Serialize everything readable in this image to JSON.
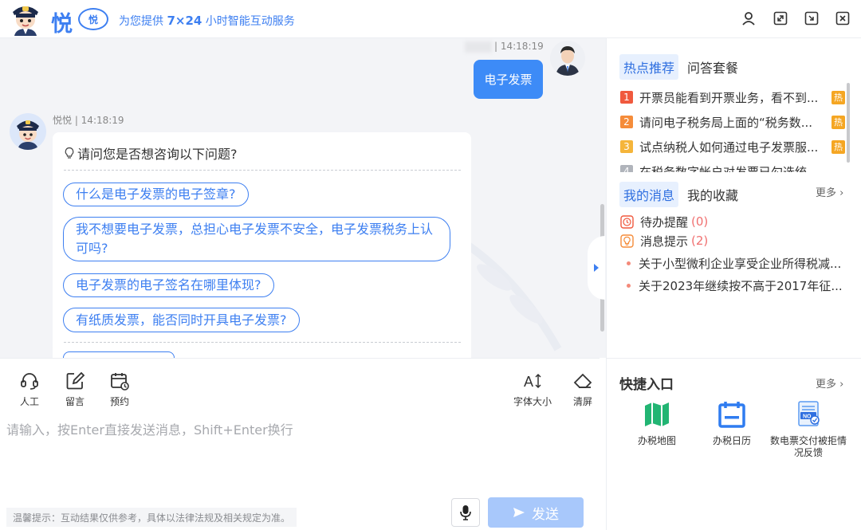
{
  "header": {
    "brand": "悦",
    "badge": "悦",
    "slogan_prefix": "为您提供",
    "slogan_highlight": "7×24",
    "slogan_suffix": "小时智能互动服务",
    "icons": [
      "user-icon",
      "expand-icon",
      "minimize-icon",
      "close-icon"
    ]
  },
  "chat": {
    "user_message": {
      "meta": "| 14:18:19",
      "text": "电子发票"
    },
    "bot_message": {
      "meta": "悦悦 | 14:18:19",
      "question": "请问您是否想咨询以下问题?",
      "suggestions": [
        "什么是电子发票的电子签章?",
        "我不想要电子发票，总担心电子发票不安全，电子发票税务上认可吗?",
        "电子发票的电子签名在哪里体现?",
        "有纸质发票，能否同时开具电子发票?"
      ]
    }
  },
  "toolbar": {
    "human": "人工",
    "leave_msg": "留言",
    "appointment": "预约",
    "font_size": "字体大小",
    "clear": "清屏"
  },
  "input": {
    "placeholder": "请输入，按Enter直接发送消息，Shift+Enter换行"
  },
  "footer": {
    "tip": "温馨提示：互动结果仅供参考，具体以法律法规及相关规定为准。",
    "send": "发送"
  },
  "hot": {
    "tab_active": "热点推荐",
    "tab_other": "问答套餐",
    "badge": "热",
    "items": [
      {
        "rank": "1",
        "text": "开票员能看到开票业务，看不到..."
      },
      {
        "rank": "2",
        "text": "请问电子税务局上面的“税务数..."
      },
      {
        "rank": "3",
        "text": "试点纳税人如何通过电子发票服..."
      },
      {
        "rank": "4",
        "text": "在税务数字帐户对发票已勾选统计确..."
      }
    ],
    "colors": {
      "rank1": "#f0593e",
      "rank2": "#f58c3a",
      "rank3": "#f5b53a",
      "rank4": "#b0b4bb"
    }
  },
  "messages": {
    "tab_active": "我的消息",
    "tab_other": "我的收藏",
    "more": "更多",
    "todo_label": "待办提醒",
    "todo_count": "(0)",
    "notice_label": "消息提示",
    "notice_count": "(2)",
    "news": [
      "关于小型微利企业享受企业所得税减...",
      "关于2023年继续按不高于2017年征..."
    ]
  },
  "quick": {
    "title": "快捷入口",
    "more": "更多",
    "items": [
      {
        "label": "办税地图",
        "icon": "map-icon"
      },
      {
        "label": "办税日历",
        "icon": "calendar-icon"
      },
      {
        "label": "数电票交付被拒情况反馈",
        "icon": "invoice-feedback-icon"
      }
    ]
  }
}
